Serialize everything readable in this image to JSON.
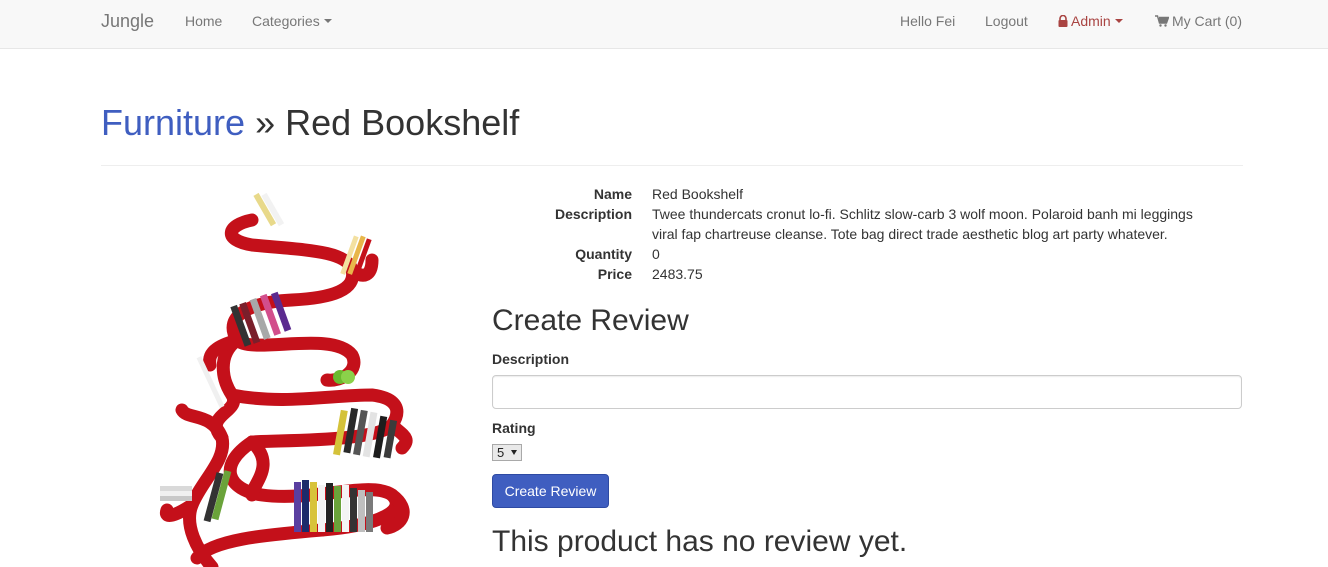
{
  "navbar": {
    "brand": "Jungle",
    "home": "Home",
    "categories": "Categories",
    "greeting": "Hello Fei",
    "logout": "Logout",
    "admin": "Admin",
    "cart": "My Cart (0)"
  },
  "header": {
    "category": "Furniture",
    "separator": " » ",
    "product": "Red Bookshelf"
  },
  "product": {
    "fields": [
      {
        "label": "Name",
        "value": "Red Bookshelf"
      },
      {
        "label": "Description",
        "value": "Twee thundercats cronut lo-fi. Schlitz slow-carb 3 wolf moon. Polaroid banh mi leggings viral fap chartreuse cleanse. Tote bag direct trade aesthetic blog art party whatever."
      },
      {
        "label": "Quantity",
        "value": "0"
      },
      {
        "label": "Price",
        "value": "2483.75"
      }
    ]
  },
  "review_form": {
    "title": "Create Review",
    "description_label": "Description",
    "description_value": "",
    "rating_label": "Rating",
    "rating_selected": "5",
    "submit_label": "Create Review"
  },
  "reviews": {
    "empty_message": "This product has no review yet."
  },
  "colors": {
    "accent": "#3f5ec0",
    "admin": "#a94442",
    "shelf_red": "#c4101a"
  }
}
